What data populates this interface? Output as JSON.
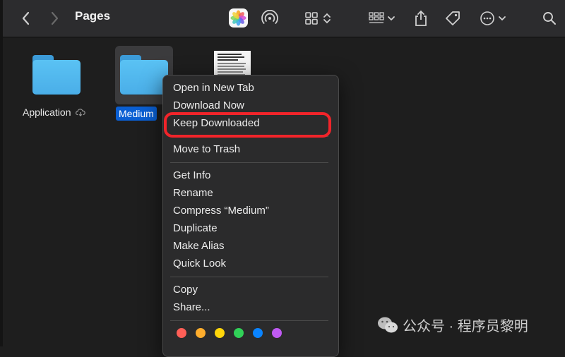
{
  "toolbar": {
    "title": "Pages"
  },
  "files": [
    {
      "name": "Application"
    },
    {
      "name": "Medium"
    }
  ],
  "context_menu": {
    "items": [
      "Open in New Tab",
      "Download Now",
      "Keep Downloaded",
      "Move to Trash",
      "Get Info",
      "Rename",
      "Compress “Medium”",
      "Duplicate",
      "Make Alias",
      "Quick Look",
      "Copy",
      "Share..."
    ],
    "tag_colors": [
      "#ff5f57",
      "#ffae2d",
      "#ffd60a",
      "#31d158",
      "#0a84ff",
      "#bf5af2"
    ]
  },
  "annotation_color": "#f1242a",
  "watermark": "公众号 · 程序员黎明"
}
